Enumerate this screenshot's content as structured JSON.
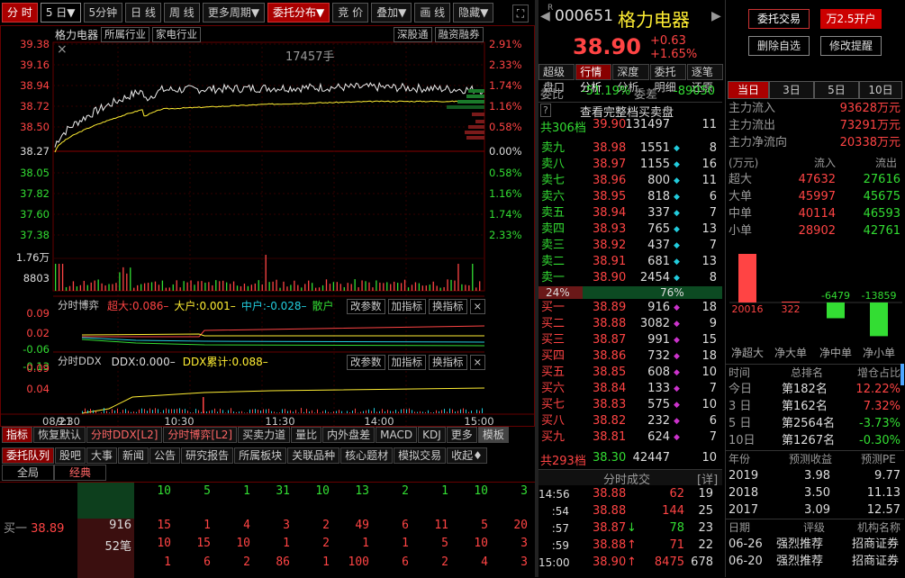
{
  "toolbar": {
    "tabs": [
      "分 时",
      "5 日▼",
      "5分钟",
      "日 线",
      "周 线",
      "更多周期▼",
      "委托分布▼",
      "竞 价",
      "叠加▼",
      "画 线",
      "隐藏▼"
    ]
  },
  "chart": {
    "stock_name": "格力电器",
    "tags": [
      "所属行业",
      "家电行业"
    ],
    "right_tags": [
      "深股通",
      "融资融券"
    ],
    "volume_label": "17457手",
    "price_ticks": [
      "39.38",
      "39.16",
      "38.94",
      "38.72",
      "38.50",
      "38.27",
      "38.05",
      "37.82",
      "37.60",
      "37.38"
    ],
    "pct_ticks": [
      "2.91%",
      "2.33%",
      "1.74%",
      "1.16%",
      "0.58%",
      "0.00%",
      "0.58%",
      "1.16%",
      "1.74%",
      "2.33%"
    ],
    "vol_ticks": [
      "1.76万",
      "8803"
    ],
    "date_label": "08/21",
    "time_ticks": [
      "9:30",
      "10:30",
      "11:30",
      "14:00",
      "15:00"
    ],
    "chart_data": {
      "type": "line",
      "x": [
        "9:30",
        "10:30",
        "11:30",
        "14:00",
        "15:00"
      ],
      "ylim": [
        37.38,
        39.38
      ],
      "series": [
        {
          "values": [
            38.3,
            38.9,
            38.92,
            38.93,
            38.9
          ]
        },
        {
          "values": [
            38.25,
            38.7,
            38.75,
            38.78,
            38.78
          ]
        }
      ]
    }
  },
  "ind1": {
    "label": "分时博弈",
    "items": [
      {
        "k": "超大:",
        "v": "0.086–",
        "c": "red"
      },
      {
        "k": "大户:",
        "v": "0.001–",
        "c": "yellow"
      },
      {
        "k": "中户:",
        "v": "-0.028–",
        "c": "cyan"
      },
      {
        "k": "散户",
        "v": "",
        "c": "green"
      }
    ],
    "btns": [
      "改参数",
      "加指标",
      "换指标"
    ],
    "ticks": [
      "0.09",
      "0.02",
      "-0.06",
      "-0.13"
    ]
  },
  "ind2": {
    "label": "分时DDX",
    "items": [
      {
        "k": "DDX:",
        "v": "0.000–",
        "c": "white"
      },
      {
        "k": "DDX累计:",
        "v": "0.088–",
        "c": "yellow"
      }
    ],
    "btns": [
      "改参数",
      "加指标",
      "换指标"
    ],
    "ticks": [
      "0.09",
      "0.04"
    ]
  },
  "bottom_tabs": [
    "指标",
    "恢复默认",
    "分时DDX[L2]",
    "分时博弈[L2]",
    "买卖力道",
    "量比",
    "内外盘差",
    "MACD",
    "KDJ",
    "更多",
    "模板"
  ],
  "lower_tabs": [
    "委托队列",
    "股吧",
    "大事",
    "新闻",
    "公告",
    "研究报告",
    "所属板块",
    "关联品种",
    "核心题材",
    "模拟交易",
    "收起♦"
  ],
  "lower_sub": [
    "全局",
    "经典"
  ],
  "queue": {
    "top": [
      "10",
      "5",
      "1",
      "31",
      "10",
      "13",
      "2",
      "1",
      "10",
      "3"
    ],
    "label": "买一",
    "price": "38.89",
    "qty": "916",
    "cnt": "52笔",
    "r1": [
      "15",
      "1",
      "4",
      "3",
      "2",
      "49",
      "6",
      "11",
      "5",
      "20"
    ],
    "r2": [
      "10",
      "15",
      "10",
      "1",
      "2",
      "1",
      "1",
      "5",
      "10",
      "3"
    ],
    "r3": [
      "1",
      "6",
      "2",
      "86",
      "1",
      "100",
      "6",
      "2",
      "4",
      "3"
    ]
  },
  "stock": {
    "code": "000651",
    "name": "格力电器",
    "price": "38.90",
    "chg": "+0.63",
    "pct": "+1.65%",
    "btns": [
      "委托交易",
      "万2.5开户",
      "删除自选",
      "修改提醒"
    ]
  },
  "mid_tabs": [
    "超级盘口",
    "行情分析",
    "深度分析",
    "委托明细",
    "逐笔还原"
  ],
  "order": {
    "weibi_k": "委比",
    "weibi_v": "-51.19%",
    "weicha_k": "委差",
    "weicha_v": "-89050",
    "full_btn": "查看完整档买卖盘",
    "total_k": "共306档",
    "total_p": "39.90",
    "total_v": "131497",
    "total_n": "11",
    "sells": [
      [
        "卖九",
        "38.98",
        "1551",
        "8"
      ],
      [
        "卖八",
        "38.97",
        "1155",
        "16"
      ],
      [
        "卖七",
        "38.96",
        "800",
        "11"
      ],
      [
        "卖六",
        "38.95",
        "818",
        "6"
      ],
      [
        "卖五",
        "38.94",
        "337",
        "7"
      ],
      [
        "卖四",
        "38.93",
        "765",
        "13"
      ],
      [
        "卖三",
        "38.92",
        "437",
        "7"
      ],
      [
        "卖二",
        "38.91",
        "681",
        "13"
      ],
      [
        "卖一",
        "38.90",
        "2454",
        "8"
      ]
    ],
    "bar_l": "24%",
    "bar_r": "76%",
    "buys": [
      [
        "买一",
        "38.89",
        "916",
        "18"
      ],
      [
        "买二",
        "38.88",
        "3082",
        "9"
      ],
      [
        "买三",
        "38.87",
        "991",
        "15"
      ],
      [
        "买四",
        "38.86",
        "732",
        "18"
      ],
      [
        "买五",
        "38.85",
        "608",
        "10"
      ],
      [
        "买六",
        "38.84",
        "133",
        "7"
      ],
      [
        "买七",
        "38.83",
        "575",
        "10"
      ],
      [
        "买八",
        "38.82",
        "232",
        "6"
      ],
      [
        "买九",
        "38.81",
        "624",
        "7"
      ]
    ],
    "btotal_k": "共293档",
    "btotal_p": "38.30",
    "btotal_v": "42447",
    "btotal_n": "10"
  },
  "ticks": {
    "title": "分时成交",
    "detail": "[详]",
    "rows": [
      [
        "14:56",
        "38.88",
        "62",
        "19",
        ""
      ],
      [
        ":54",
        "38.88",
        "144",
        "25",
        ""
      ],
      [
        ":57",
        "38.87",
        "78",
        "23",
        "dn"
      ],
      [
        ":59",
        "38.88",
        "71",
        "22",
        "up"
      ],
      [
        "15:00",
        "38.90",
        "8475",
        "678",
        "up"
      ]
    ]
  },
  "flow": {
    "tabs": [
      "当日",
      "3日",
      "5日",
      "10日"
    ],
    "main": [
      [
        "主力流入",
        "93628万元"
      ],
      [
        "主力流出",
        "73291万元"
      ],
      [
        "主力净流向",
        "20338万元"
      ]
    ],
    "hdr": [
      "(万元)",
      "流入",
      "流出"
    ],
    "rows": [
      [
        "超大",
        "47632",
        "27616"
      ],
      [
        "大单",
        "45997",
        "45675"
      ],
      [
        "中单",
        "40114",
        "46593"
      ],
      [
        "小单",
        "28902",
        "42761"
      ]
    ],
    "bars": [
      {
        "v": 20016,
        "label": "20016"
      },
      {
        "v": 322,
        "label": "322"
      },
      {
        "v": -6479,
        "label": "-6479"
      },
      {
        "v": -13859,
        "label": "-13859"
      }
    ],
    "bar_labels": [
      "净超大",
      "净大单",
      "净中单",
      "净小单"
    ],
    "rank_hdr": [
      "时间",
      "总排名",
      "增仓占比"
    ],
    "ranks": [
      [
        "今日",
        "第182名",
        "12.22%"
      ],
      [
        "3 日",
        "第162名",
        "7.32%"
      ],
      [
        "5 日",
        "第2564名",
        "-3.73%"
      ],
      [
        "10日",
        "第1267名",
        "-0.30%"
      ]
    ],
    "eps_hdr": [
      "年份",
      "预测收益",
      "预测PE"
    ],
    "eps": [
      [
        "2019",
        "3.98",
        "9.77"
      ],
      [
        "2018",
        "3.50",
        "11.13"
      ],
      [
        "2017",
        "3.09",
        "12.57"
      ]
    ],
    "rate_hdr": [
      "日期",
      "评级",
      "机构名称"
    ],
    "rates": [
      [
        "06-26",
        "强烈推荐",
        "招商证券"
      ],
      [
        "06-20",
        "强烈推荐",
        "招商证券"
      ]
    ]
  }
}
